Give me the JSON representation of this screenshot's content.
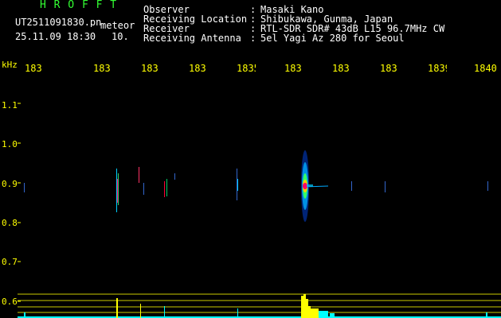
{
  "brand": "H R O F F T",
  "file_name": "UT2511091830.pn",
  "mode": "meteor",
  "date_time": "25.11.09 18:30",
  "interval": "10.",
  "info": [
    {
      "label": "Observer",
      "value": "Masaki Kano"
    },
    {
      "label": "Receiving Location",
      "value": "Shibukawa, Gunma, Japan"
    },
    {
      "label": "Receiver",
      "value": "RTL-SDR SDR# 43dB L15 96.7MHz CW"
    },
    {
      "label": "Receiving Antenna",
      "value": "5el Yagi Az 280 for Seoul"
    }
  ],
  "x_ticks": [
    "183",
    "183:",
    "183;",
    "183.",
    "1835",
    "183(",
    "183'",
    "183(",
    "1839",
    "1840"
  ],
  "y_unit": "kHz",
  "y_ticks": [
    "1.1",
    "1.0",
    "0.9",
    "0.8",
    "0.7",
    "0.6"
  ],
  "colors": {
    "text": "#ffffff",
    "brand": "#33ff33",
    "axis": "#ffff00",
    "plot_bg": "#000000",
    "level_bar": "#ffff00",
    "level_base": "#00ffff"
  }
}
